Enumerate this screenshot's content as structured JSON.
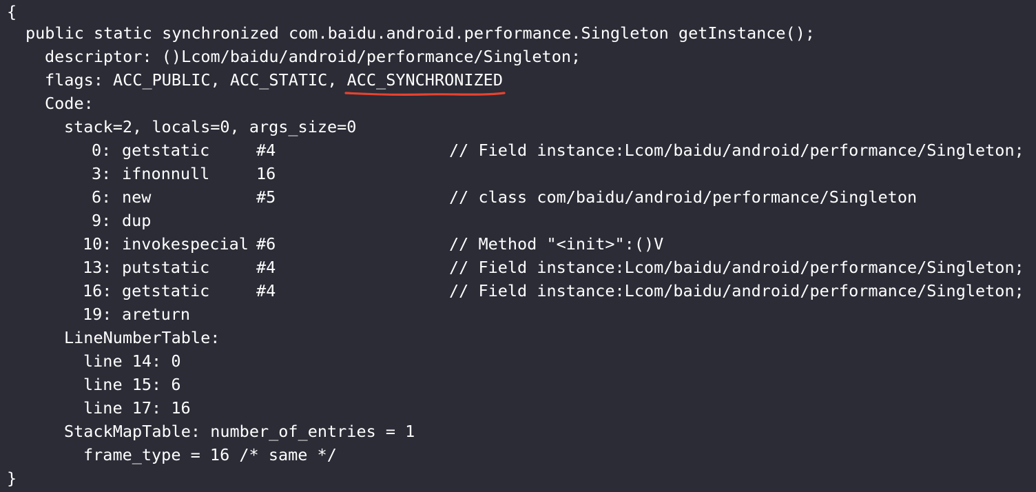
{
  "code": {
    "open_brace": "{",
    "method_signature": "public static synchronized com.baidu.android.performance.Singleton getInstance();",
    "descriptor": "descriptor: ()Lcom/baidu/android/performance/Singleton;",
    "flags_prefix": "flags: ACC_PUBLIC, ACC_STATIC, ",
    "flags_highlighted": "ACC_SYNCHRONIZED",
    "code_label": "Code:",
    "stack_info": "stack=2, locals=0, args_size=0",
    "instructions": [
      {
        "offset": "0:",
        "op": "getstatic",
        "arg": "#4",
        "comment": "// Field instance:Lcom/baidu/android/performance/Singleton;"
      },
      {
        "offset": "3:",
        "op": "ifnonnull",
        "arg": "16",
        "comment": ""
      },
      {
        "offset": "6:",
        "op": "new",
        "arg": "#5",
        "comment": "// class com/baidu/android/performance/Singleton"
      },
      {
        "offset": "9:",
        "op": "dup",
        "arg": "",
        "comment": ""
      },
      {
        "offset": "10:",
        "op": "invokespecial",
        "arg": "#6",
        "comment": "// Method \"<init>\":()V"
      },
      {
        "offset": "13:",
        "op": "putstatic",
        "arg": "#4",
        "comment": "// Field instance:Lcom/baidu/android/performance/Singleton;"
      },
      {
        "offset": "16:",
        "op": "getstatic",
        "arg": "#4",
        "comment": "// Field instance:Lcom/baidu/android/performance/Singleton;"
      },
      {
        "offset": "19:",
        "op": "areturn",
        "arg": "",
        "comment": ""
      }
    ],
    "line_number_table_label": "LineNumberTable:",
    "line_numbers": [
      "line 14: 0",
      "line 15: 6",
      "line 17: 16"
    ],
    "stack_map_table": "StackMapTable: number_of_entries = 1",
    "frame_type": "frame_type = 16 /* same */",
    "close_brace": "}"
  },
  "colors": {
    "background": "#2b2c36",
    "text": "#ffffff",
    "underline": "#e8422f"
  }
}
